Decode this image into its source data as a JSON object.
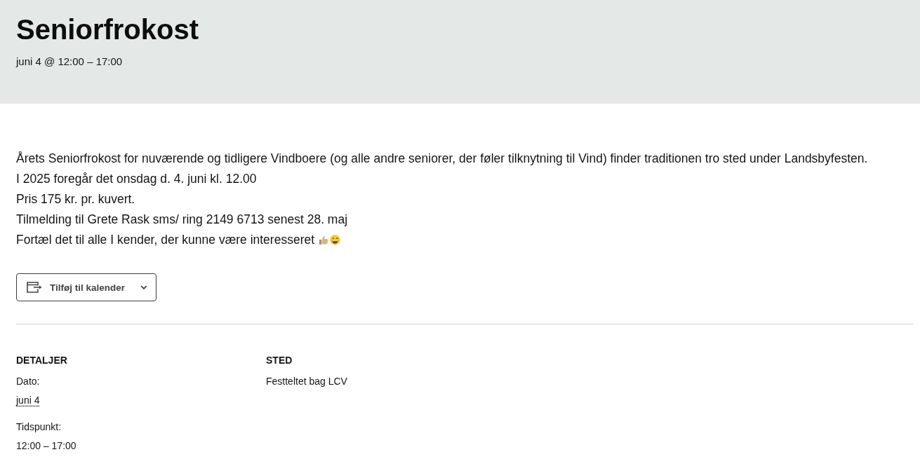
{
  "header": {
    "title": "Seniorfrokost",
    "datetime": "juni 4 @ 12:00 – 17:00"
  },
  "description": {
    "lines": [
      "Årets Seniorfrokost for nuværende og tidligere Vindboere (og alle andre seniorer, der føler tilknytning til Vind) finder traditionen tro sted under Landsbyfesten.",
      "I 2025 foregår det onsdag d. 4. juni kl. 12.00",
      "Pris 175 kr. pr. kuvert.",
      "Tilmelding til Grete Rask sms/ ring 2149 6713 senest 28. maj",
      "Fortæl det til alle I kender, der kunne være interesseret"
    ]
  },
  "add_to_calendar": {
    "label": "Tilføj til kalender"
  },
  "details": {
    "heading": "DETALJER",
    "fields": [
      {
        "kind": "date",
        "label": "Dato:",
        "value": "juni 4"
      },
      {
        "kind": "time",
        "label": "Tidspunkt:",
        "value": "12:00 – 17:00"
      }
    ]
  },
  "venue": {
    "heading": "STED",
    "name": "Festteltet bag LCV"
  }
}
